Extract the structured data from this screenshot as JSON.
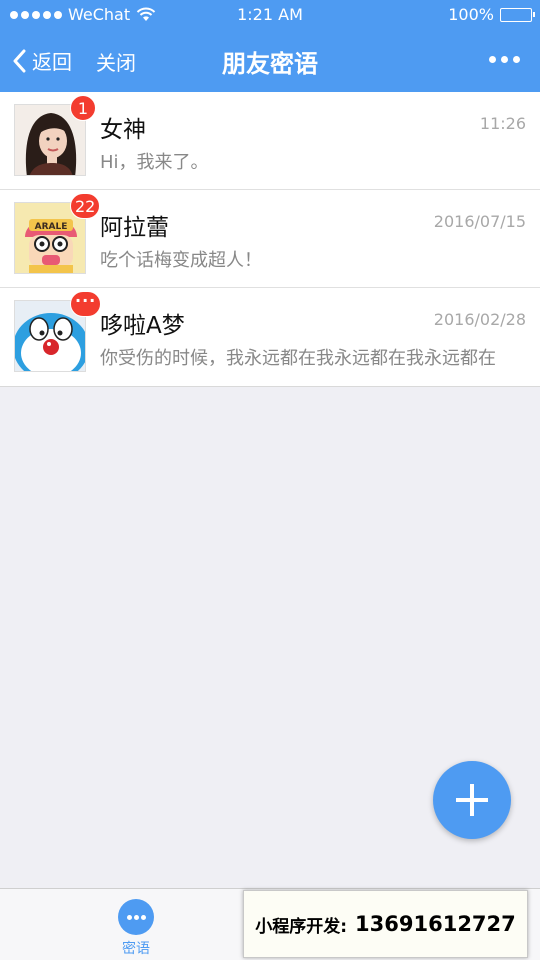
{
  "status_bar": {
    "carrier": "WeChat",
    "time": "1:21 AM",
    "battery": "100%",
    "battery_level": 1.0
  },
  "nav": {
    "back_label": "返回",
    "close_label": "关闭",
    "title": "朋友密语"
  },
  "contacts": [
    {
      "name": "女神",
      "preview": "Hi，我来了。",
      "date": "11:26",
      "badge": "1"
    },
    {
      "name": "阿拉蕾",
      "preview": "吃个话梅变成超人！",
      "date": "2016/07/15",
      "badge": "22"
    },
    {
      "name": "哆啦A梦",
      "preview": "你受伤的时候，我永远都在我永远都在我永远都在",
      "date": "2016/02/28",
      "badge": "···"
    }
  ],
  "tabbar": {
    "tab_label": "密语"
  },
  "promo": {
    "label": "小程序开发:",
    "phone": "13691612727"
  },
  "colors": {
    "brand": "#4e9bf2",
    "badge": "#f33c2f"
  }
}
